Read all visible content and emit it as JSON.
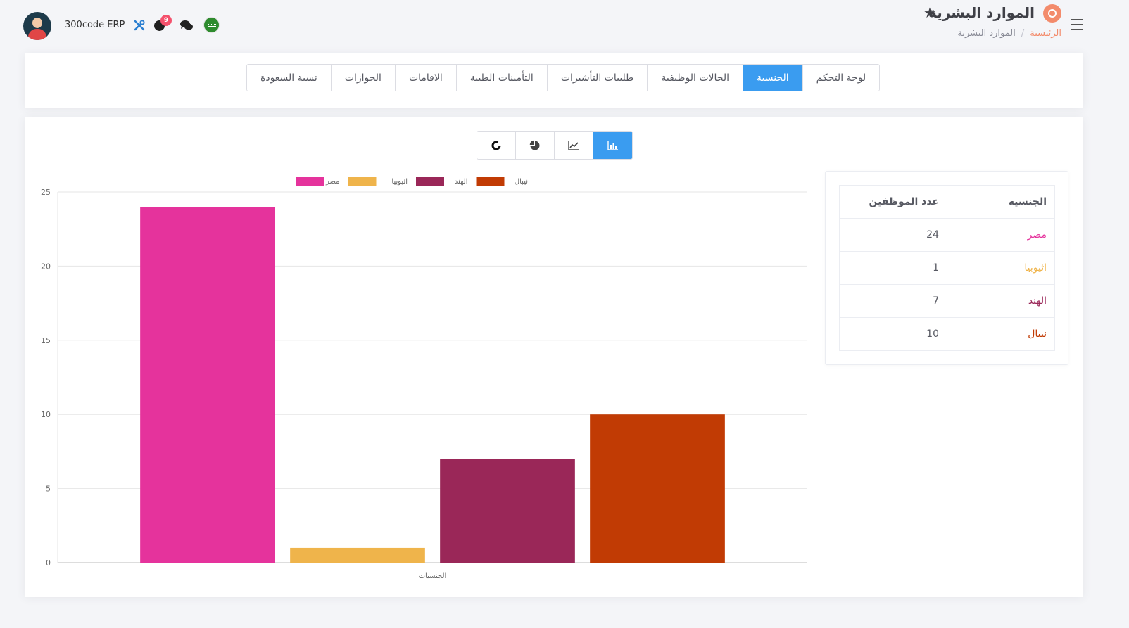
{
  "header": {
    "brand": "300code ERP",
    "notification_count": "9",
    "page_title": "الموارد البشرية",
    "breadcrumb": {
      "home": "الرئيسية",
      "current": "الموارد البشرية"
    }
  },
  "tabs": [
    {
      "label": "لوحة التحكم",
      "active": false
    },
    {
      "label": "الجنسية",
      "active": true
    },
    {
      "label": "الحالات الوظيفية",
      "active": false
    },
    {
      "label": "طلبيات التأشيرات",
      "active": false
    },
    {
      "label": "التأمينات الطبية",
      "active": false
    },
    {
      "label": "الاقامات",
      "active": false
    },
    {
      "label": "الجوازات",
      "active": false
    },
    {
      "label": "نسبة السعودة",
      "active": false
    }
  ],
  "chart_switcher": [
    {
      "icon": "bar-chart-icon",
      "active": true
    },
    {
      "icon": "line-chart-icon",
      "active": false
    },
    {
      "icon": "pie-chart-icon",
      "active": false
    },
    {
      "icon": "donut-chart-icon",
      "active": false
    }
  ],
  "table": {
    "headers": {
      "nationality": "الجنسية",
      "count": "عدد الموظفين"
    },
    "rows": [
      {
        "nationality": "مصر",
        "count": "24",
        "color": "#e5339c"
      },
      {
        "nationality": "اثيوبيا",
        "count": "1",
        "color": "#efb44b"
      },
      {
        "nationality": "الهند",
        "count": "7",
        "color": "#9a2758"
      },
      {
        "nationality": "نيبال",
        "count": "10",
        "color": "#c13b04"
      }
    ]
  },
  "chart_data": {
    "type": "bar",
    "xlabel": "الجنسيات",
    "ylabel": "",
    "ylim": [
      0,
      25
    ],
    "yticks": [
      0,
      5,
      10,
      15,
      20,
      25
    ],
    "grid": true,
    "legend_position": "top",
    "series": [
      {
        "name": "مصر",
        "values": [
          24
        ],
        "color": "#e5339c"
      },
      {
        "name": "اثيوبيا",
        "values": [
          1
        ],
        "color": "#efb44b"
      },
      {
        "name": "الهند",
        "values": [
          7
        ],
        "color": "#9a2758"
      },
      {
        "name": "نيبال",
        "values": [
          10
        ],
        "color": "#c13b04"
      }
    ]
  }
}
